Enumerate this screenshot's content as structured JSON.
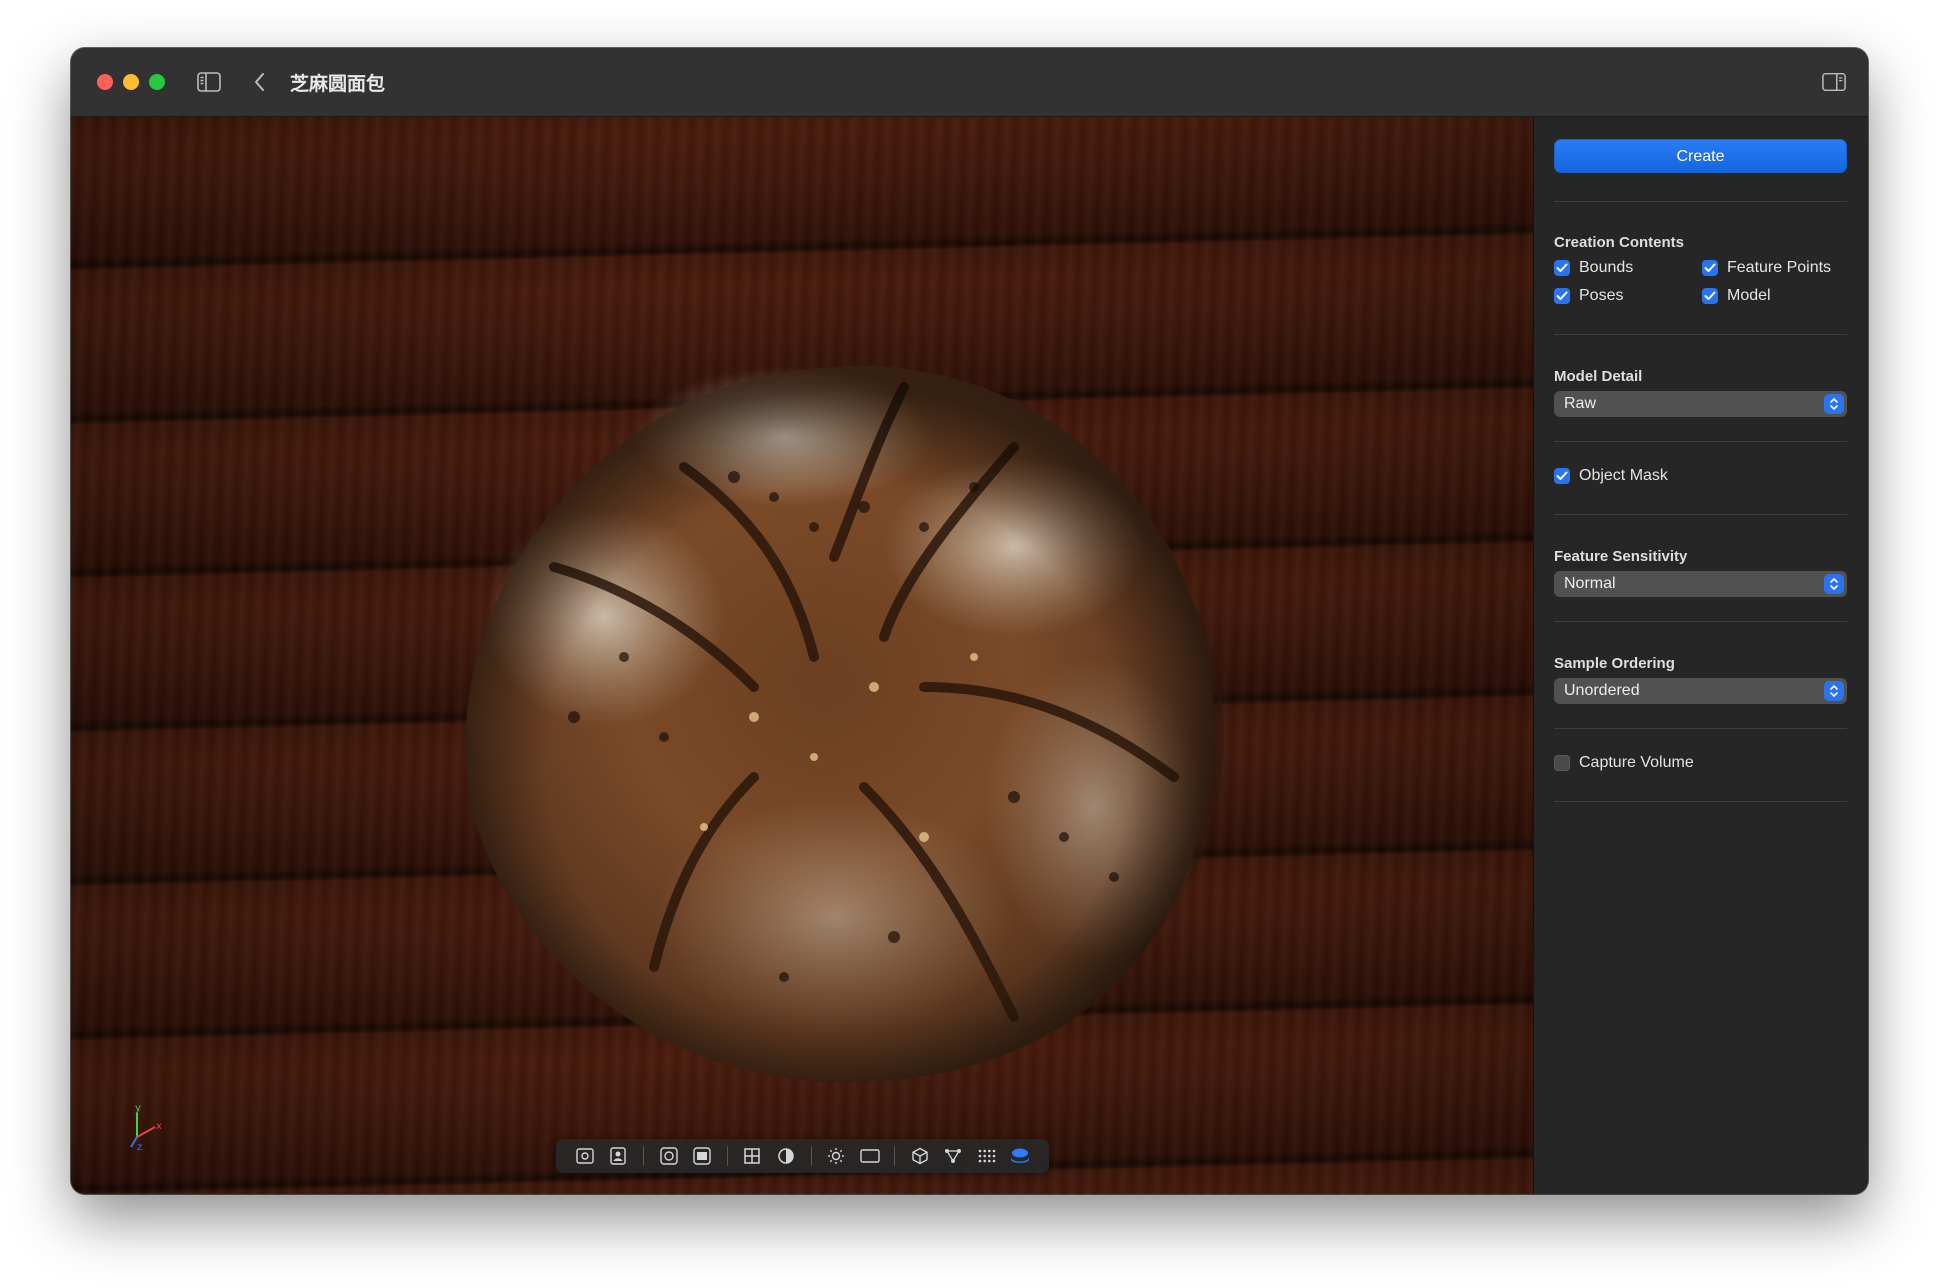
{
  "window": {
    "title": "芝麻圆面包"
  },
  "titlebar": {
    "icons": [
      "sidebar-toggle-icon",
      "chevron-left-icon",
      "inspector-toggle-icon"
    ]
  },
  "toolbar": {
    "tools": [
      "camera-frame-icon",
      "portrait-icon",
      "circle-frame-icon",
      "image-frame-icon",
      "grid-icon",
      "contrast-icon",
      "brightness-icon",
      "rectangle-icon",
      "cube-icon",
      "nodes-icon",
      "point-grid-icon",
      "model-stack-icon"
    ],
    "active_tool": "model-stack-icon"
  },
  "inspector": {
    "create_label": "Create",
    "creation_contents": {
      "label": "Creation Contents",
      "items": [
        {
          "label": "Bounds",
          "checked": true
        },
        {
          "label": "Feature Points",
          "checked": true
        },
        {
          "label": "Poses",
          "checked": true
        },
        {
          "label": "Model",
          "checked": true
        }
      ]
    },
    "model_detail": {
      "label": "Model Detail",
      "value": "Raw"
    },
    "object_mask": {
      "label": "Object Mask",
      "checked": true
    },
    "feature_sensitivity": {
      "label": "Feature Sensitivity",
      "value": "Normal"
    },
    "sample_ordering": {
      "label": "Sample Ordering",
      "value": "Unordered"
    },
    "capture_volume": {
      "label": "Capture Volume",
      "checked": false
    }
  },
  "axis_gizmo": {
    "labels": [
      "y",
      "x",
      "z"
    ]
  },
  "colors": {
    "accent": "#2a74f0",
    "window_bg": "#262626",
    "titlebar_bg": "#323232",
    "close": "#ff5f57",
    "minimize": "#febc2e",
    "maximize": "#28c840"
  }
}
